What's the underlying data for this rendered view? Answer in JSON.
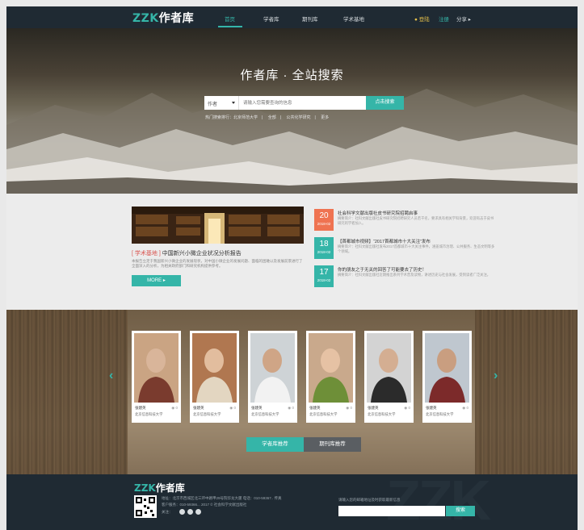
{
  "nav": {
    "logo_prefix": "ZZK",
    "logo_text": "作者库",
    "links": [
      "首页",
      "学者库",
      "期刊库",
      "学术基地"
    ],
    "login": "登陆",
    "register": "注册",
    "share": "分享 ▸"
  },
  "hero": {
    "title": "作者库 · 全站搜索",
    "select_value": "作者",
    "search_placeholder": "请输入您需要查询的信息",
    "search_button": "点击搜索",
    "hot_items": [
      "热门搜索排行：北京师范大学",
      "全部",
      "公共化学研究",
      "更多"
    ]
  },
  "news": {
    "feature_tag": "[ 学术基地 ]",
    "feature_title": " 中国新兴小微企业状况分析报告",
    "feature_desc": "本报告立足于我国新兴小微企业的发展现状，对中国小微企业的发展问题、面临的困难以及发展前景进行了全面深入的分析，为相关政府部门和研究机构提供参考。",
    "more": "MORE ▸",
    "items": [
      {
        "day": "20",
        "ym": "2018-02",
        "color": "#ef7351",
        "title": "社会科学文献出版社皮书研究院招聘启事",
        "desc": "摘要简介：社科文献出版社皮书研究院招聘研究人员若干名，要求具有相关学科背景，欢迎有志于皮书研究的学者加入。"
      },
      {
        "day": "18",
        "ym": "2018-02",
        "color": "#35b5a8",
        "title": "【首都城市视频】“2017首都城市十大关注”发布",
        "desc": "摘要简介：社科文献出版社发布2017首都城市十大关注事件，涵盖城市治理、公共服务、生态文明等多个领域。"
      },
      {
        "day": "17",
        "ym": "2018-02",
        "color": "#35b5a8",
        "title": "你的朋友之于无关的回答了可能要去了历史！",
        "desc": "摘要简介：社科文献出版社近期推出系列学术普及读物，讲述历史与社会发展，受到读者广泛关注。"
      }
    ]
  },
  "people": {
    "cards": [
      {
        "name": "张建英",
        "count": "0",
        "org": "北京信息科技大学"
      },
      {
        "name": "张建英",
        "count": "0",
        "org": "北京信息科技大学"
      },
      {
        "name": "张建英",
        "count": "0",
        "org": "北京信息科技大学"
      },
      {
        "name": "张建英",
        "count": "0",
        "org": "北京信息科技大学"
      },
      {
        "name": "张建英",
        "count": "0",
        "org": "北京信息科技大学"
      },
      {
        "name": "张建英",
        "count": "0",
        "org": "北京信息科技大学"
      }
    ],
    "tab_scholars": "学者库推荐",
    "tab_journals": "期刊库推荐"
  },
  "footer": {
    "logo_prefix": "ZZK",
    "logo_text": "作者库",
    "line1": "地址：北京市西城区北三环中路甲29号院华龙大厦  电话：010-59367..  传真",
    "line2": "客户服务：010-59366...  2017 © 社会科学文献出版社",
    "follow": "关注：",
    "subscribe_label": "请输入您的邮箱地址及时获取最新信息",
    "search_button": "搜索",
    "watermark": "ZZK"
  },
  "colors": {
    "accent": "#35b5a8",
    "nav_bg": "#1f2a33",
    "date_red": "#ef7351",
    "tab_dark": "#5a5e62"
  }
}
